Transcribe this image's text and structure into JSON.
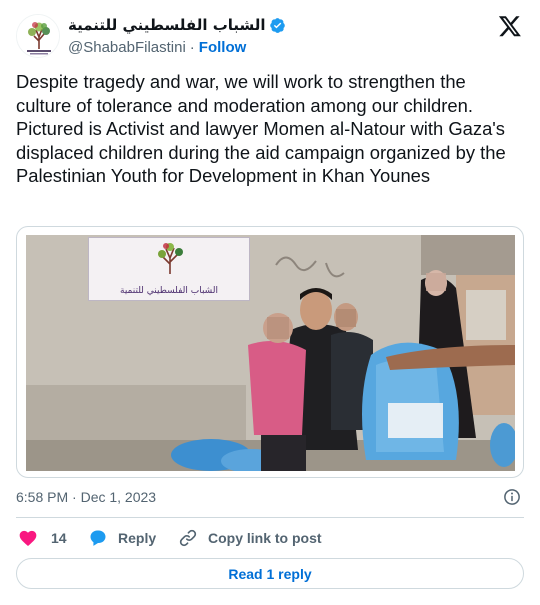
{
  "colors": {
    "accent": "#006fd6",
    "verified": "#1d9bf0",
    "like": "#f91880",
    "muted": "#536471",
    "text": "#0f1419",
    "border": "#cfd9de"
  },
  "author": {
    "display_name": "الشباب الفلسطيني للتنمية",
    "handle": "@ShababFilastini",
    "separator": "·",
    "follow_label": "Follow",
    "avatar_icon": "tree-logo-icon",
    "verified_icon": "verified-badge-icon"
  },
  "header": {
    "logo_icon": "x-logo-icon"
  },
  "tweet": {
    "text": "Despite tragedy and war, we will work to strengthen the culture of tolerance and moderation among our children. Pictured is Activist and lawyer Momen al-Natour with Gaza's displaced children during the aid campaign organized by the Palestinian Youth for Development in Khan Younes",
    "timestamp": "6:58 PM · Dec 1, 2023",
    "info_icon": "info-icon"
  },
  "media": {
    "banner_text": "الشباب الفلسطيني للتنمية"
  },
  "actions": {
    "like_count": "14",
    "reply_label": "Reply",
    "copy_label": "Copy link to post"
  },
  "footer": {
    "read_replies_label": "Read 1 reply"
  }
}
